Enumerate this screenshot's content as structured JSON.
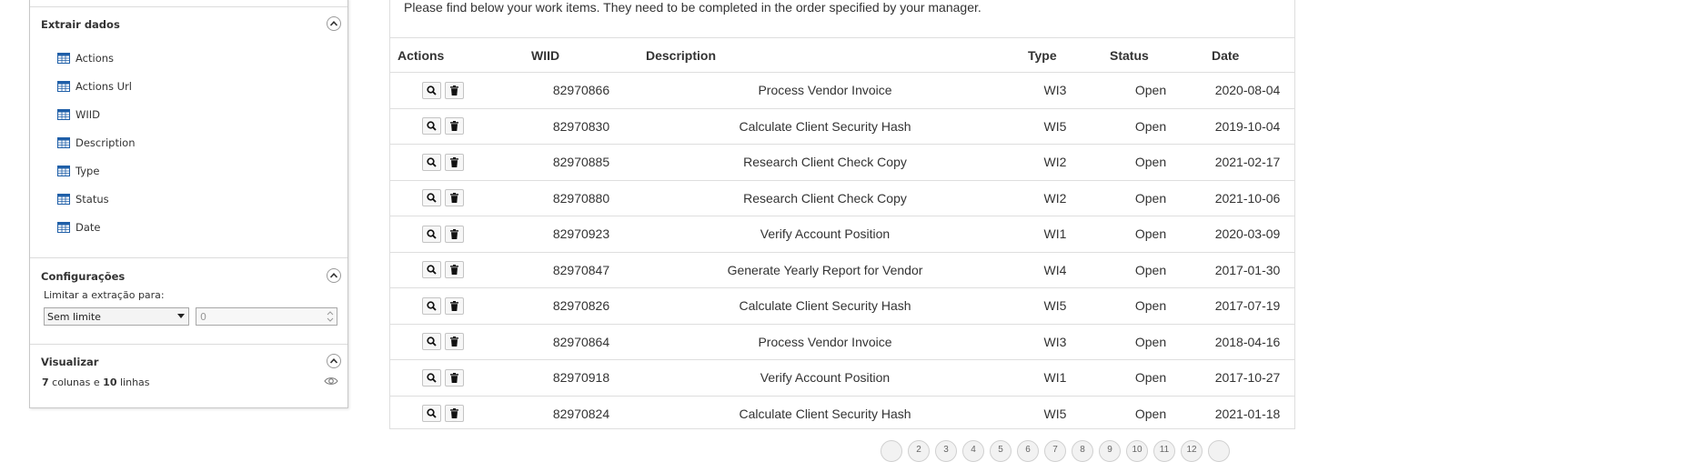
{
  "panel": {
    "extract": {
      "title": "Extrair dados",
      "fields": [
        "Actions",
        "Actions Url",
        "WIID",
        "Description",
        "Type",
        "Status",
        "Date"
      ]
    },
    "config": {
      "title": "Configurações",
      "limit_label": "Limitar a extração para:",
      "limit_selected": "Sem limite",
      "limit_value_placeholder": "0"
    },
    "preview": {
      "title": "Visualizar",
      "columns_count": "7",
      "columns_word": "colunas e",
      "rows_count": "10",
      "rows_word": "linhas"
    }
  },
  "main": {
    "intro": "Please find below your work items. They need to be completed in the order specified by your manager.",
    "columns": [
      "Actions",
      "WIID",
      "Description",
      "Type",
      "Status",
      "Date"
    ],
    "rows": [
      {
        "wiid": "82970866",
        "description": "Process Vendor Invoice",
        "type": "WI3",
        "status": "Open",
        "date": "2020-08-04"
      },
      {
        "wiid": "82970830",
        "description": "Calculate Client Security Hash",
        "type": "WI5",
        "status": "Open",
        "date": "2019-10-04"
      },
      {
        "wiid": "82970885",
        "description": "Research Client Check Copy",
        "type": "WI2",
        "status": "Open",
        "date": "2021-02-17"
      },
      {
        "wiid": "82970880",
        "description": "Research Client Check Copy",
        "type": "WI2",
        "status": "Open",
        "date": "2021-10-06"
      },
      {
        "wiid": "82970923",
        "description": "Verify Account Position",
        "type": "WI1",
        "status": "Open",
        "date": "2020-03-09"
      },
      {
        "wiid": "82970847",
        "description": "Generate Yearly Report for Vendor",
        "type": "WI4",
        "status": "Open",
        "date": "2017-01-30"
      },
      {
        "wiid": "82970826",
        "description": "Calculate Client Security Hash",
        "type": "WI5",
        "status": "Open",
        "date": "2017-07-19"
      },
      {
        "wiid": "82970864",
        "description": "Process Vendor Invoice",
        "type": "WI3",
        "status": "Open",
        "date": "2018-04-16"
      },
      {
        "wiid": "82970918",
        "description": "Verify Account Position",
        "type": "WI1",
        "status": "Open",
        "date": "2017-10-27"
      },
      {
        "wiid": "82970824",
        "description": "Calculate Client Security Hash",
        "type": "WI5",
        "status": "Open",
        "date": "2021-01-18"
      }
    ],
    "pages": [
      "",
      "2",
      "3",
      "4",
      "5",
      "6",
      "7",
      "8",
      "9",
      "10",
      "11",
      "12",
      ""
    ]
  },
  "colors": {
    "icon_blue": "#1f5fa8",
    "border": "#dedede",
    "text": "#333333"
  }
}
